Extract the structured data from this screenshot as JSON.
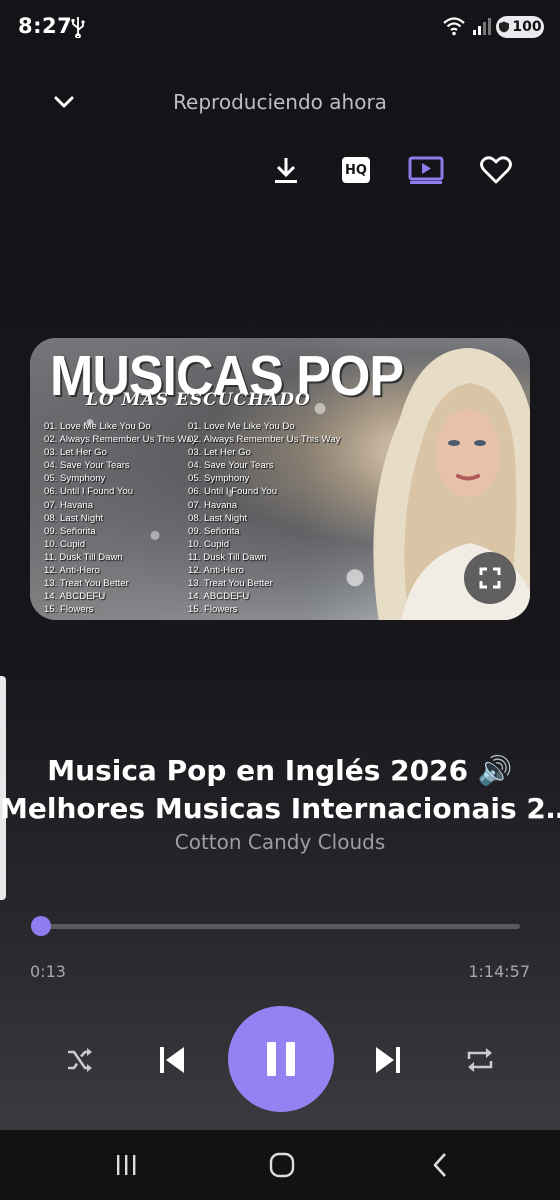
{
  "status_bar": {
    "time": "8:27",
    "battery": "100",
    "icons": [
      "usb-icon",
      "wifi-icon",
      "signal-icon",
      "battery-shield-icon"
    ]
  },
  "header": {
    "title": "Reproduciendo ahora",
    "collapse_icon": "chevron-down-icon"
  },
  "actions": [
    {
      "name": "download-button",
      "icon": "download-icon"
    },
    {
      "name": "hq-button",
      "icon": "hq-icon",
      "label": "HQ"
    },
    {
      "name": "video-mode-button",
      "icon": "play-screen-icon",
      "active": true
    },
    {
      "name": "favorite-button",
      "icon": "heart-icon"
    }
  ],
  "artwork": {
    "title": "MUSICAS POP",
    "subtitle": "LO MAS ESCUCHADO",
    "tracks_left": [
      "01. Love Me Like You Do",
      "02. Always Remember Us This Way",
      "03. Let Her Go",
      "04. Save Your Tears",
      "05. Symphony",
      "06. Until I Found You",
      "07. Havana",
      "08. Last Night",
      "09. Señorita",
      "10. Cupid",
      "11. Dusk Till Dawn",
      "12. Anti-Hero",
      "13. Treat You Better",
      "14. ABCDEFU",
      "15. Flowers"
    ],
    "tracks_right": [
      "01. Love Me Like You Do",
      "02. Always Remember Us This Way",
      "03. Let Her Go",
      "04. Save Your Tears",
      "05. Symphony",
      "06. Until I Found You",
      "07. Havana",
      "08. Last Night",
      "09. Señorita",
      "10. Cupid",
      "11. Dusk Till Dawn",
      "12. Anti-Hero",
      "13. Treat You Better",
      "14. ABCDEFU",
      "15. Flowers"
    ]
  },
  "song": {
    "title_line1": "Musica Pop en Inglés 2026 🔊",
    "title_line2": "Melhores Musicas Internacionais 2…",
    "artist": "Cotton Candy Clouds"
  },
  "playback": {
    "elapsed": "0:13",
    "total": "1:14:57",
    "progress": 0.003,
    "state": "playing"
  },
  "colors": {
    "accent": "#9582f2",
    "background": "#141418",
    "secondary_text": "#9c9ca3"
  }
}
